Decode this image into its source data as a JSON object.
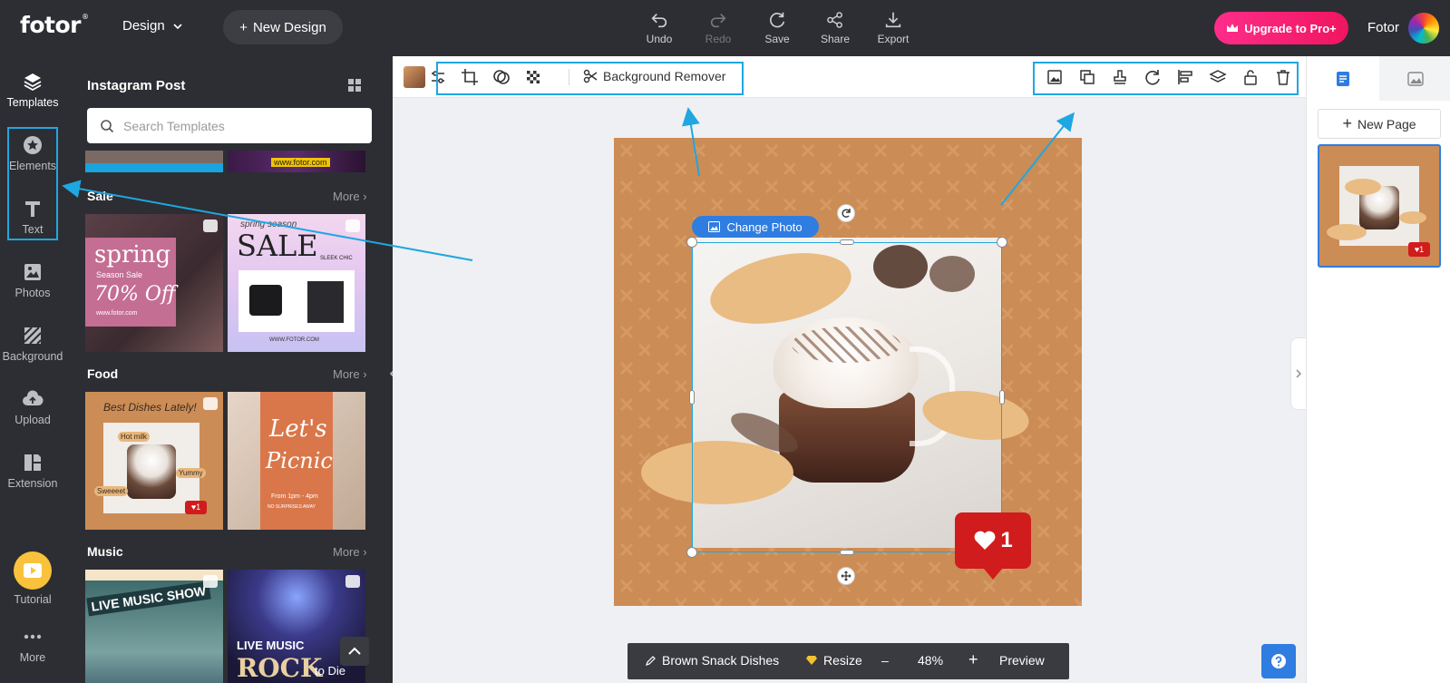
{
  "header": {
    "logo": "fotor",
    "logo_mark": "®",
    "design_menu": "Design",
    "new_design": "New Design",
    "tools": [
      {
        "label": "Undo",
        "icon": "undo-icon"
      },
      {
        "label": "Redo",
        "icon": "redo-icon"
      },
      {
        "label": "Save",
        "icon": "save-icon"
      },
      {
        "label": "Share",
        "icon": "share-icon"
      },
      {
        "label": "Export",
        "icon": "export-icon"
      }
    ],
    "upgrade": "Upgrade to Pro+",
    "user_name": "Fotor"
  },
  "rail": {
    "items": [
      {
        "label": "Templates",
        "icon": "layers-icon"
      },
      {
        "label": "Elements",
        "icon": "star-icon"
      },
      {
        "label": "Text",
        "icon": "text-icon"
      },
      {
        "label": "Photos",
        "icon": "image-icon"
      },
      {
        "label": "Background",
        "icon": "background-icon"
      },
      {
        "label": "Upload",
        "icon": "cloud-upload-icon"
      },
      {
        "label": "Extension",
        "icon": "extension-icon"
      }
    ],
    "tutorial": "Tutorial",
    "more": "More"
  },
  "panel": {
    "title": "Instagram Post",
    "search_placeholder": "Search Templates",
    "top_thumb_text": "www.fotor.com",
    "more_label": "More",
    "sections": [
      {
        "title": "Sale",
        "thumbs": [
          {
            "lines": [
              "spring",
              "Season Sale",
              "70% Off",
              "www.fotor.com"
            ]
          },
          {
            "lines": [
              "spring season",
              "SALE",
              "SLEEK CHIC",
              "WWW.FOTOR.COM"
            ]
          }
        ]
      },
      {
        "title": "Food",
        "thumbs": [
          {
            "lines": [
              "Best Dishes Lately!",
              "Hot milk",
              "Yummy",
              "Sweeeet"
            ]
          },
          {
            "lines": [
              "Let's",
              "Picnic",
              "From 1pm - 4pm",
              "NO SURPRISES AWAY"
            ]
          }
        ]
      },
      {
        "title": "Music",
        "thumbs": [
          {
            "lines": [
              "LIVE MUSIC SHOW"
            ]
          },
          {
            "lines": [
              "LIVE MUSIC",
              "ROCK",
              "to Die"
            ]
          }
        ]
      }
    ],
    "like_count": "1"
  },
  "context_toolbar": {
    "background_remover": "Background Remover",
    "left_tools": [
      "adjust-icon",
      "crop-icon",
      "mask-icon",
      "transparency-icon"
    ],
    "right_tools": [
      "replace-image-icon",
      "duplicate-icon",
      "stamp-icon",
      "flip-icon",
      "align-icon",
      "layers-icon",
      "lock-icon",
      "delete-icon"
    ]
  },
  "canvas": {
    "change_photo": "Change Photo",
    "like_count": "1",
    "bg_color": "#cc8c55"
  },
  "bottom_bar": {
    "template_name": "Brown Snack Dishes",
    "resize": "Resize",
    "zoom": "48%",
    "preview": "Preview",
    "minus": "–",
    "plus": "+"
  },
  "right_panel": {
    "new_page": "New Page",
    "page_like_count": "1"
  },
  "colors": {
    "accent": "#1ea7e1",
    "brand_blue": "#2f7de1",
    "upgrade_pink": "#f0155f",
    "dark": "#2d2e33"
  }
}
